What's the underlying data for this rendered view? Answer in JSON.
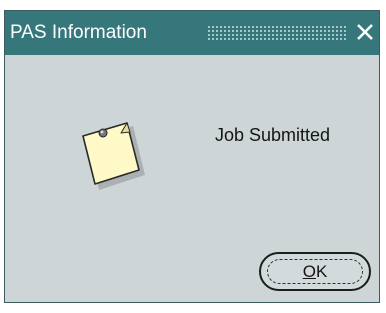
{
  "window": {
    "title": "PAS Information",
    "close_icon": "close-icon",
    "colors": {
      "titlebar": "#36777c",
      "body": "#cdd5d6"
    }
  },
  "content": {
    "icon": "note-icon",
    "message": "Job Submitted"
  },
  "buttons": {
    "ok_mnemonic": "O",
    "ok_rest": "K"
  }
}
